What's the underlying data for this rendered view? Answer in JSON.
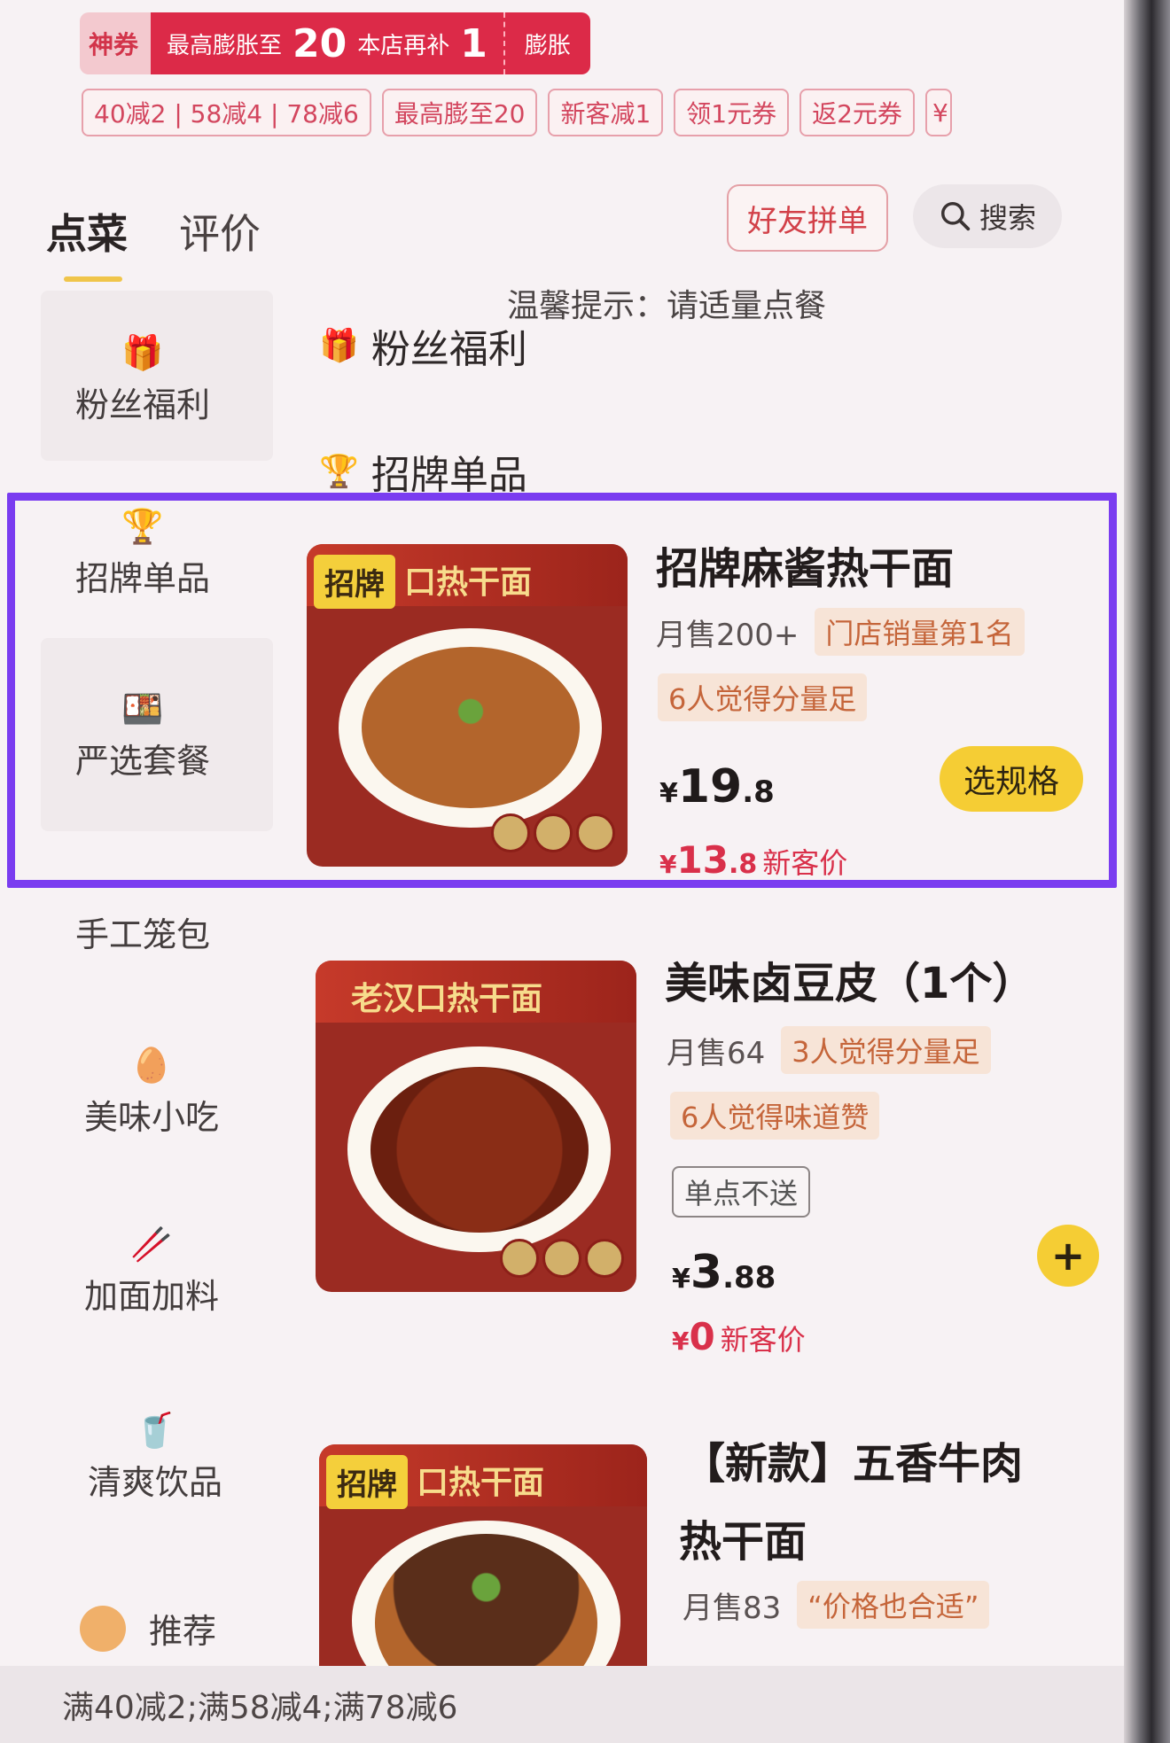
{
  "promo": {
    "shenquan": "神券",
    "expand_text1": "最高膨胀至",
    "expand_num1": "20",
    "expand_text2": "本店再补",
    "expand_num2": "1",
    "expand_button": "膨胀"
  },
  "coupons": [
    "40减2 | 58减4 | 78减6",
    "最高膨至20",
    "新客减1",
    "领1元券",
    "返2元券",
    "¥"
  ],
  "tabs": {
    "order": "点菜",
    "reviews": "评价"
  },
  "actions": {
    "group_order": "好友拼单",
    "search": "搜索"
  },
  "tip": "温馨提示：请适量点餐",
  "sidebar": {
    "items": [
      {
        "label": "粉丝福利",
        "icon": "gift-icon"
      },
      {
        "label": "招牌单品",
        "icon": "trophy-icon"
      },
      {
        "label": "严选套餐",
        "icon": "bento-icon"
      },
      {
        "label": "手工笼包",
        "icon": "bun-icon"
      },
      {
        "label": "美味小吃",
        "icon": "egg-icon"
      },
      {
        "label": "加面加料",
        "icon": "noodle-icon"
      },
      {
        "label": "清爽饮品",
        "icon": "drink-icon"
      },
      {
        "label": "推荐",
        "icon": "recommend-icon"
      }
    ]
  },
  "sections": {
    "fans": "粉丝福利",
    "signature": "招牌单品"
  },
  "products": [
    {
      "name": "招牌麻酱热干面",
      "img_tag": "招牌",
      "img_brand": "口热干面",
      "sales": "月售200+",
      "tag1": "门店销量第1名",
      "tag2": "6人觉得分量足",
      "price_int": "19",
      "price_dec": ".8",
      "new_price_int": "13",
      "new_price_dec": ".8",
      "new_price_label": "新客价",
      "button": "选规格"
    },
    {
      "name": "美味卤豆皮（1个）",
      "img_brand": "老汉口热干面",
      "sales": "月售64",
      "tag1": "3人觉得分量足",
      "tag2": "6人觉得味道赞",
      "note": "单点不送",
      "price_int": "3",
      "price_dec": ".88",
      "new_price_int": "0",
      "new_price_label": "新客价",
      "button": "+"
    },
    {
      "name_line1": "【新款】五香牛肉",
      "name_line2": "热干面",
      "img_tag": "招牌",
      "img_brand": "口热干面",
      "sales": "月售83",
      "tag1": "“价格也合适”"
    }
  ],
  "footer": "满40减2;满58减4;满78减6",
  "colors": {
    "accent_red": "#dc2a48",
    "button_yellow": "#f5cd34",
    "highlight_purple": "#7a3cf0"
  }
}
